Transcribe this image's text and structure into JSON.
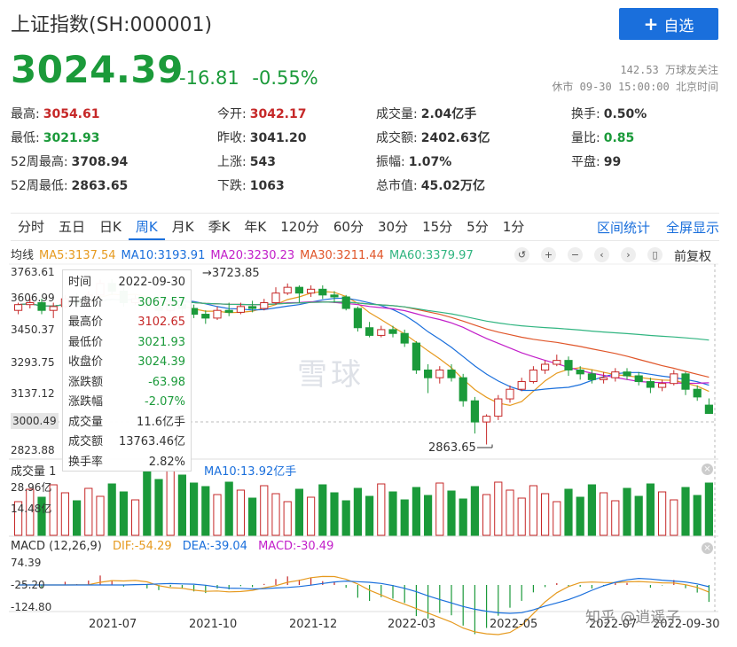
{
  "header": {
    "title": "上证指数(SH:000001)",
    "follow_label": "自选",
    "price": "3024.39",
    "change": "-16.81",
    "change_pct": "-0.55%",
    "followers": "142.53 万球友关注",
    "status": "休市 09-30 15:00:00 北京时间"
  },
  "stats": [
    {
      "k": "最高:",
      "v": "3054.61",
      "tone": "red"
    },
    {
      "k": "今开:",
      "v": "3042.17",
      "tone": "red"
    },
    {
      "k": "成交量:",
      "v": "2.04亿手",
      "tone": ""
    },
    {
      "k": "换手:",
      "v": "0.50%",
      "tone": ""
    },
    {
      "k": "最低:",
      "v": "3021.93",
      "tone": "green"
    },
    {
      "k": "昨收:",
      "v": "3041.20",
      "tone": ""
    },
    {
      "k": "成交额:",
      "v": "2402.63亿",
      "tone": ""
    },
    {
      "k": "量比:",
      "v": "0.85",
      "tone": "green"
    },
    {
      "k": "52周最高:",
      "v": "3708.94",
      "tone": ""
    },
    {
      "k": "上涨:",
      "v": "543",
      "tone": ""
    },
    {
      "k": "振幅:",
      "v": "1.07%",
      "tone": ""
    },
    {
      "k": "平盘:",
      "v": "99",
      "tone": ""
    },
    {
      "k": "52周最低:",
      "v": "2863.65",
      "tone": ""
    },
    {
      "k": "下跌:",
      "v": "1063",
      "tone": ""
    },
    {
      "k": "总市值:",
      "v": "45.02万亿",
      "tone": ""
    }
  ],
  "tabs": [
    "分时",
    "五日",
    "日K",
    "周K",
    "月K",
    "季K",
    "年K",
    "120分",
    "60分",
    "30分",
    "15分",
    "5分",
    "1分"
  ],
  "active_tab": "周K",
  "tab_actions": [
    "区间统计",
    "全屏显示"
  ],
  "ma_legend": {
    "label": "均线",
    "items": [
      {
        "text": "MA5:3137.54",
        "color": "#e69a1f"
      },
      {
        "text": "MA10:3193.91",
        "color": "#1a6fdc"
      },
      {
        "text": "MA20:3230.23",
        "color": "#c21ec9"
      },
      {
        "text": "MA30:3211.44",
        "color": "#e0562a"
      },
      {
        "text": "MA60:3379.97",
        "color": "#31b581"
      }
    ]
  },
  "controls": {
    "reset_label": "前复权"
  },
  "price_axis": [
    "3763.61",
    "3606.99",
    "3450.37",
    "3293.75",
    "3137.12",
    "3000.49",
    "2823.88"
  ],
  "annotations": {
    "high": "3723.85",
    "low": "2863.65"
  },
  "tooltip": [
    {
      "k": "时间",
      "v": "2022-09-30",
      "tone": ""
    },
    {
      "k": "开盘价",
      "v": "3067.57",
      "tone": "green"
    },
    {
      "k": "最高价",
      "v": "3102.65",
      "tone": "red"
    },
    {
      "k": "最低价",
      "v": "3021.93",
      "tone": "green"
    },
    {
      "k": "收盘价",
      "v": "3024.39",
      "tone": "green"
    },
    {
      "k": "涨跌额",
      "v": "-63.98",
      "tone": "green"
    },
    {
      "k": "涨跌幅",
      "v": "-2.07%",
      "tone": "green"
    },
    {
      "k": "成交量",
      "v": "11.6亿手",
      "tone": ""
    },
    {
      "k": "成交额",
      "v": "13763.46亿",
      "tone": ""
    },
    {
      "k": "换手率",
      "v": "2.82%",
      "tone": ""
    }
  ],
  "volume": {
    "label": "成交量 1",
    "ma10": "MA10:13.92亿手",
    "axis": [
      "28.96亿",
      "14.48亿"
    ]
  },
  "macd": {
    "label": "MACD (12,26,9)",
    "dif": "DIF:-54.29",
    "dea": "DEA:-39.04",
    "macd": "MACD:-30.49",
    "axis": [
      "74.39",
      "-25.20",
      "-124.80"
    ]
  },
  "dates": [
    "2021-07",
    "2021-10",
    "2021-12",
    "2022-03",
    "2022-05",
    "2022-07",
    "2022-09-30"
  ],
  "watermark": "雪球",
  "credit": "知乎 @逍遥子",
  "colors": {
    "up": "#c62828",
    "down": "#1b9a3a",
    "accent": "#1a6fdc"
  },
  "chart_data": {
    "type": "candlestick",
    "note_series": "weekly candles, approximate",
    "candles": [
      [
        3560,
        3590,
        3540,
        3600
      ],
      [
        3590,
        3600,
        3570,
        3620
      ],
      [
        3600,
        3560,
        3540,
        3620
      ],
      [
        3560,
        3580,
        3520,
        3600
      ],
      [
        3580,
        3620,
        3570,
        3640
      ],
      [
        3620,
        3600,
        3580,
        3650
      ],
      [
        3600,
        3640,
        3590,
        3660
      ],
      [
        3640,
        3700,
        3630,
        3720
      ],
      [
        3700,
        3660,
        3640,
        3723
      ],
      [
        3660,
        3600,
        3580,
        3680
      ],
      [
        3600,
        3620,
        3590,
        3640
      ],
      [
        3620,
        3580,
        3560,
        3630
      ],
      [
        3580,
        3560,
        3540,
        3600
      ],
      [
        3560,
        3590,
        3550,
        3610
      ],
      [
        3590,
        3570,
        3540,
        3600
      ],
      [
        3570,
        3540,
        3520,
        3590
      ],
      [
        3540,
        3520,
        3490,
        3560
      ],
      [
        3520,
        3560,
        3510,
        3580
      ],
      [
        3560,
        3550,
        3530,
        3600
      ],
      [
        3550,
        3580,
        3540,
        3600
      ],
      [
        3580,
        3570,
        3550,
        3610
      ],
      [
        3570,
        3600,
        3560,
        3620
      ],
      [
        3600,
        3650,
        3590,
        3680
      ],
      [
        3650,
        3680,
        3640,
        3700
      ],
      [
        3680,
        3650,
        3600,
        3690
      ],
      [
        3650,
        3670,
        3630,
        3690
      ],
      [
        3670,
        3640,
        3620,
        3690
      ],
      [
        3640,
        3630,
        3600,
        3660
      ],
      [
        3630,
        3570,
        3560,
        3640
      ],
      [
        3570,
        3470,
        3450,
        3580
      ],
      [
        3470,
        3430,
        3420,
        3500
      ],
      [
        3430,
        3460,
        3420,
        3480
      ],
      [
        3460,
        3440,
        3420,
        3480
      ],
      [
        3440,
        3390,
        3370,
        3460
      ],
      [
        3390,
        3250,
        3230,
        3400
      ],
      [
        3250,
        3210,
        3130,
        3280
      ],
      [
        3210,
        3250,
        3180,
        3270
      ],
      [
        3250,
        3210,
        3190,
        3280
      ],
      [
        3210,
        3090,
        3060,
        3230
      ],
      [
        3090,
        2980,
        2920,
        3110
      ],
      [
        2980,
        3010,
        2863,
        3020
      ],
      [
        3010,
        3100,
        2990,
        3120
      ],
      [
        3100,
        3150,
        3080,
        3170
      ],
      [
        3150,
        3190,
        3140,
        3210
      ],
      [
        3190,
        3250,
        3180,
        3270
      ],
      [
        3250,
        3280,
        3230,
        3300
      ],
      [
        3280,
        3300,
        3270,
        3330
      ],
      [
        3300,
        3250,
        3220,
        3320
      ],
      [
        3250,
        3230,
        3200,
        3270
      ],
      [
        3230,
        3200,
        3180,
        3250
      ],
      [
        3200,
        3210,
        3180,
        3240
      ],
      [
        3210,
        3240,
        3190,
        3260
      ],
      [
        3240,
        3220,
        3200,
        3260
      ],
      [
        3220,
        3190,
        3170,
        3240
      ],
      [
        3190,
        3160,
        3130,
        3210
      ],
      [
        3160,
        3180,
        3140,
        3200
      ],
      [
        3180,
        3230,
        3170,
        3250
      ],
      [
        3230,
        3150,
        3120,
        3240
      ],
      [
        3150,
        3110,
        3090,
        3170
      ],
      [
        3067.57,
        3024.39,
        3021.93,
        3102.65
      ]
    ],
    "ylim": [
      2823.88,
      3763.61
    ]
  }
}
